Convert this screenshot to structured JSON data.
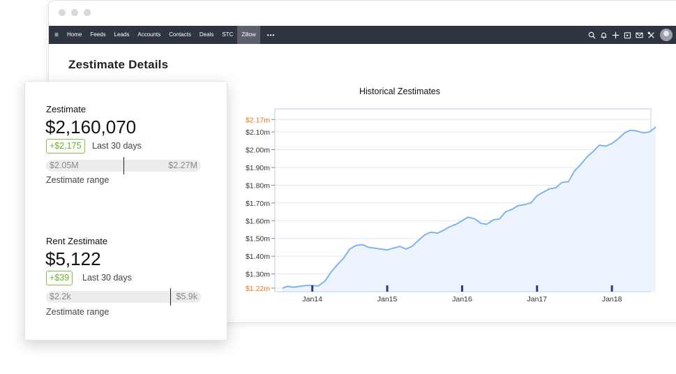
{
  "nav": {
    "menu_icon": "hamburger-icon",
    "items": [
      {
        "label": "Home"
      },
      {
        "label": "Feeds"
      },
      {
        "label": "Leads"
      },
      {
        "label": "Accounts"
      },
      {
        "label": "Contacts"
      },
      {
        "label": "Deals"
      },
      {
        "label": "STC"
      },
      {
        "label": "Zillow",
        "active": true
      }
    ],
    "more": "•••",
    "icons": [
      "search-icon",
      "bell-icon",
      "plus-icon",
      "calendar-icon",
      "mail-icon",
      "tools-icon",
      "avatar"
    ]
  },
  "page": {
    "title": "Zestimate Details"
  },
  "zestimate": {
    "title": "Zestimate",
    "value": "$2,160,070",
    "change": "+$2,175",
    "change_period": "Last 30 days",
    "range_low": "$2.05M",
    "range_high": "$2.27M",
    "range_position": 0.5,
    "range_label": "Zestimate range"
  },
  "rent_zestimate": {
    "title": "Rent Zestimate",
    "value": "$5,122",
    "change": "+$39",
    "change_period": "Last 30 days",
    "range_low": "$2.2k",
    "range_high": "$5.9k",
    "range_position": 0.8,
    "range_label": "Zestimate range"
  },
  "chart_data": {
    "type": "area",
    "title": "Historical Zestimates",
    "x_ticks": [
      "Jan14",
      "Jan15",
      "Jan16",
      "Jan17",
      "Jan18"
    ],
    "x_tick_values": [
      2014,
      2015,
      2016,
      2017,
      2018
    ],
    "xlim": [
      2013.5,
      2018.52
    ],
    "y_ticks": [
      {
        "label": "$2.17m",
        "value": 2.17,
        "highlight": true
      },
      {
        "label": "$2.10m",
        "value": 2.1
      },
      {
        "label": "$2.00m",
        "value": 2.0
      },
      {
        "label": "$1.90m",
        "value": 1.9
      },
      {
        "label": "$1.80m",
        "value": 1.8
      },
      {
        "label": "$1.70m",
        "value": 1.7
      },
      {
        "label": "$1.60m",
        "value": 1.6
      },
      {
        "label": "$1.50m",
        "value": 1.5
      },
      {
        "label": "$1.40m",
        "value": 1.4
      },
      {
        "label": "$1.30m",
        "value": 1.3
      },
      {
        "label": "$1.22m",
        "value": 1.22,
        "highlight": true
      }
    ],
    "ylim": [
      1.2,
      2.23
    ],
    "grid": true,
    "line_color": "#7fb3ee",
    "fill_color": "#eef4fd",
    "highlight_color": "#e8761f",
    "series": [
      {
        "values": [
          [
            2013.6,
            1.22
          ],
          [
            2013.67,
            1.23
          ],
          [
            2013.75,
            1.225
          ],
          [
            2013.83,
            1.23
          ],
          [
            2013.92,
            1.235
          ],
          [
            2014.0,
            1.235
          ],
          [
            2014.08,
            1.232
          ],
          [
            2014.17,
            1.26
          ],
          [
            2014.25,
            1.31
          ],
          [
            2014.33,
            1.35
          ],
          [
            2014.42,
            1.39
          ],
          [
            2014.5,
            1.44
          ],
          [
            2014.58,
            1.46
          ],
          [
            2014.67,
            1.465
          ],
          [
            2014.75,
            1.45
          ],
          [
            2014.83,
            1.445
          ],
          [
            2014.92,
            1.44
          ],
          [
            2015.0,
            1.435
          ],
          [
            2015.08,
            1.445
          ],
          [
            2015.17,
            1.455
          ],
          [
            2015.25,
            1.44
          ],
          [
            2015.33,
            1.455
          ],
          [
            2015.42,
            1.49
          ],
          [
            2015.5,
            1.52
          ],
          [
            2015.58,
            1.535
          ],
          [
            2015.67,
            1.53
          ],
          [
            2015.75,
            1.545
          ],
          [
            2015.83,
            1.565
          ],
          [
            2015.92,
            1.58
          ],
          [
            2016.0,
            1.6
          ],
          [
            2016.08,
            1.62
          ],
          [
            2016.17,
            1.61
          ],
          [
            2016.25,
            1.585
          ],
          [
            2016.33,
            1.58
          ],
          [
            2016.42,
            1.605
          ],
          [
            2016.5,
            1.61
          ],
          [
            2016.58,
            1.65
          ],
          [
            2016.67,
            1.665
          ],
          [
            2016.75,
            1.685
          ],
          [
            2016.83,
            1.69
          ],
          [
            2016.92,
            1.7
          ],
          [
            2017.0,
            1.74
          ],
          [
            2017.08,
            1.76
          ],
          [
            2017.17,
            1.78
          ],
          [
            2017.25,
            1.785
          ],
          [
            2017.33,
            1.815
          ],
          [
            2017.42,
            1.82
          ],
          [
            2017.5,
            1.88
          ],
          [
            2017.58,
            1.915
          ],
          [
            2017.67,
            1.96
          ],
          [
            2017.75,
            1.99
          ],
          [
            2017.83,
            2.025
          ],
          [
            2017.92,
            2.02
          ],
          [
            2018.0,
            2.035
          ],
          [
            2018.08,
            2.06
          ],
          [
            2018.17,
            2.095
          ],
          [
            2018.25,
            2.11
          ],
          [
            2018.33,
            2.105
          ],
          [
            2018.42,
            2.095
          ],
          [
            2018.5,
            2.1
          ],
          [
            2018.58,
            2.125
          ],
          [
            2018.67,
            2.17
          ],
          [
            2018.75,
            2.165
          ]
        ]
      }
    ]
  }
}
